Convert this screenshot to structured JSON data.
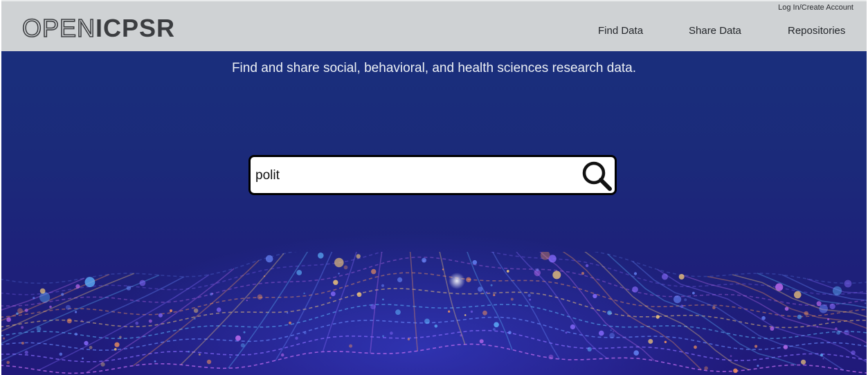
{
  "header": {
    "logo_open": "OPEN",
    "logo_icpsr": "ICPSR",
    "login_link": "Log In/Create Account",
    "nav": [
      {
        "label": "Find Data"
      },
      {
        "label": "Share Data"
      },
      {
        "label": "Repositories"
      }
    ]
  },
  "hero": {
    "tagline": "Find and share social, behavioral, and health sciences research data."
  },
  "search": {
    "value": "polit",
    "icon": "search-icon"
  },
  "colors": {
    "header_bg": "#cfd2d4",
    "hero_bg": "#1b2a7a",
    "search_border": "#000000"
  }
}
